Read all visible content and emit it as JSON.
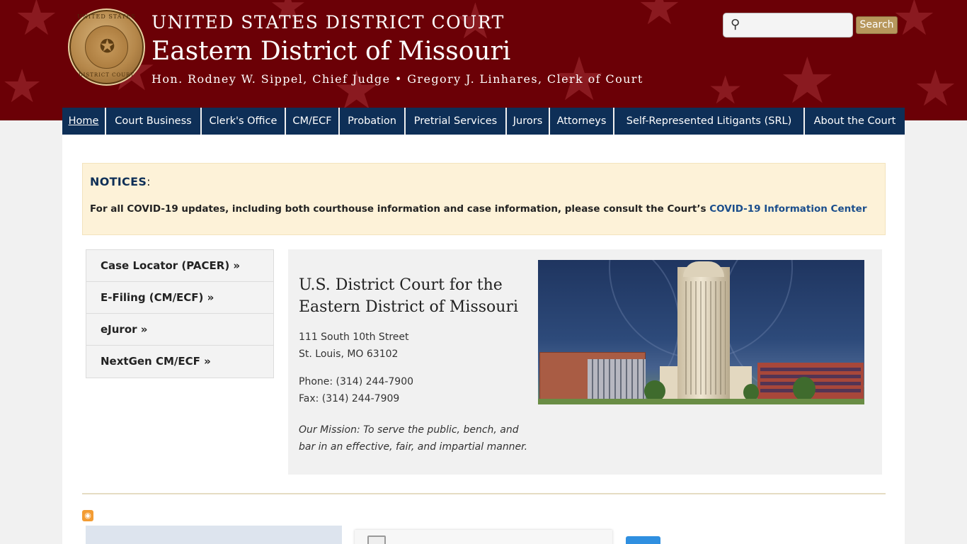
{
  "header": {
    "court_title": "UNITED STATES DISTRICT COURT",
    "district_title": "Eastern District of Missouri",
    "judges": "Hon. Rodney W. Sippel, Chief Judge • Gregory J. Linhares, Clerk of Court",
    "seal_top_text": "UNITED STATES",
    "seal_bottom_text": "DISTRICT COURT"
  },
  "search": {
    "placeholder": "",
    "value": "",
    "button_label": "Search"
  },
  "nav": {
    "items": [
      {
        "label": "Home"
      },
      {
        "label": "Court Business"
      },
      {
        "label": "Clerk's Office"
      },
      {
        "label": "CM/ECF"
      },
      {
        "label": "Probation"
      },
      {
        "label": "Pretrial Services"
      },
      {
        "label": "Jurors"
      },
      {
        "label": "Attorneys"
      },
      {
        "label": "Self-Represented Litigants (SRL)"
      },
      {
        "label": "About the Court"
      }
    ]
  },
  "notice": {
    "title": "NOTICES",
    "text": "For all COVID-19 updates, including both courthouse information and case information, please consult the Court’s ",
    "link_text": "COVID-19 Information Center"
  },
  "quick_links": [
    {
      "label": "Case Locator (PACER) »"
    },
    {
      "label": "E-Filing (CM/ECF) »"
    },
    {
      "label": "eJuror »"
    },
    {
      "label": "NextGen CM/ECF »"
    }
  ],
  "info": {
    "heading": "U.S. District Court for the Eastern District of Missouri",
    "address_line1": "111 South 10th Street",
    "address_line2": "St. Louis, MO 63102",
    "phone": "Phone: (314) 244-7900",
    "fax": "Fax: (314) 244-7909",
    "mission": "Our Mission: To serve the public, bench, and bar in an effective, fair, and impartial manner."
  },
  "colors": {
    "header_bg": "#6b0006",
    "nav_bg": "#0e2f57",
    "notice_bg": "#fdf2d8",
    "link": "#1b4e8c",
    "search_button": "#b7975c"
  },
  "icons": {
    "search": "magnifier-icon",
    "rss": "rss-icon",
    "seal": "court-seal"
  }
}
